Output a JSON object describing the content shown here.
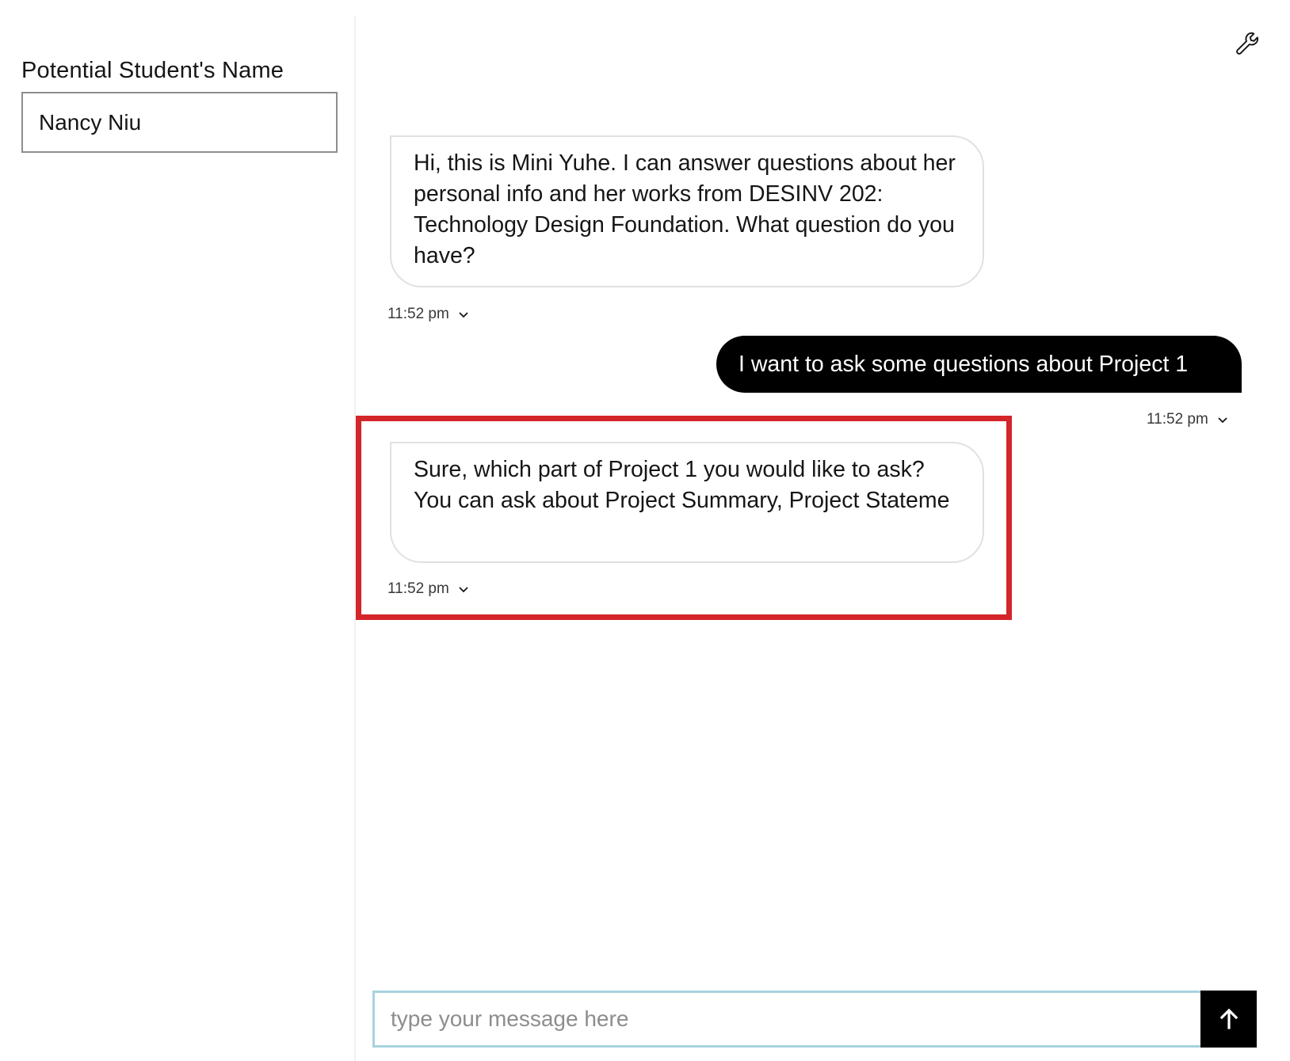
{
  "sidebar": {
    "field_label": "Potential Student's Name",
    "name_value": "Nancy Niu"
  },
  "toolbar": {
    "settings_icon": "wrench-icon"
  },
  "messages": [
    {
      "sender": "bot",
      "text": "Hi, this is Mini Yuhe. I can answer questions about her personal info and her works from DESINV 202: Technology Design Foundation. What question do you have?",
      "time": "11:52 pm"
    },
    {
      "sender": "user",
      "text": "I want to ask some questions about Project 1",
      "time": "11:52 pm"
    },
    {
      "sender": "bot",
      "text": "Sure, which part of Project 1 you would like to ask? You can ask about Project Summary, Project Stateme",
      "time": "11:52 pm",
      "highlighted": true
    }
  ],
  "composer": {
    "placeholder": "type your message here",
    "send_icon": "arrow-up-icon"
  },
  "colors": {
    "user_bubble": "#000000",
    "highlight": "#d3252a",
    "input_border": "#a6d3dd"
  }
}
